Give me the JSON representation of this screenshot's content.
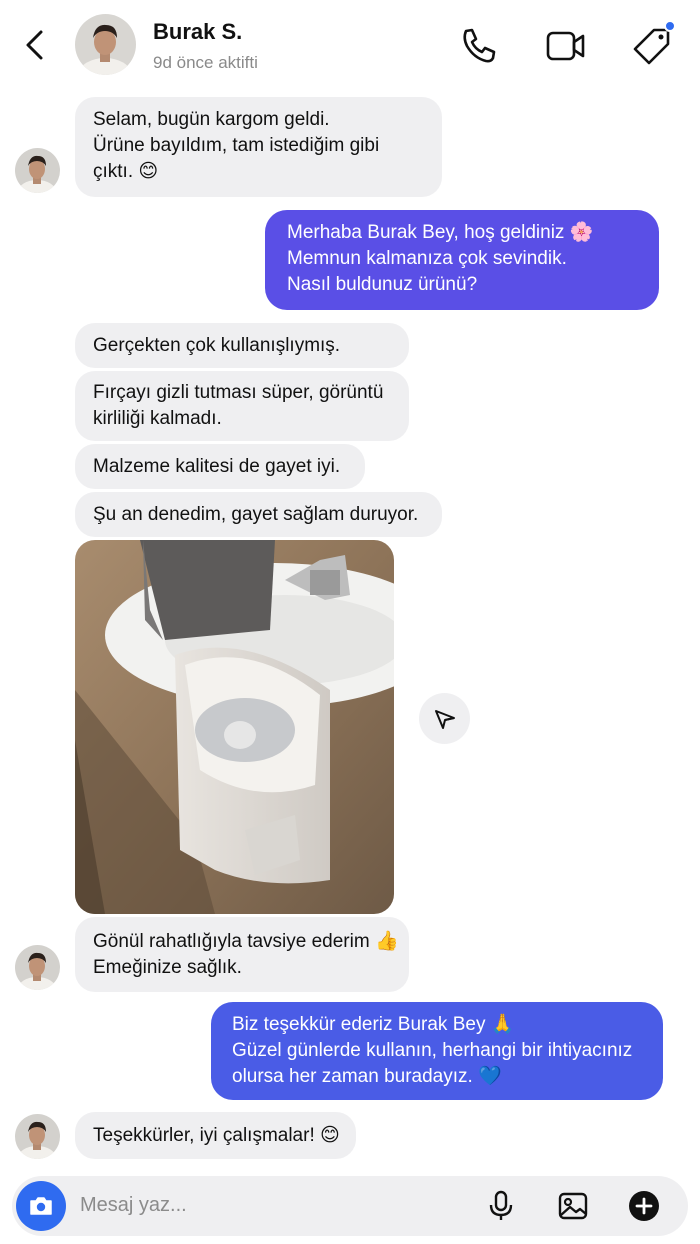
{
  "header": {
    "contact_name": "Burak S.",
    "status": "9d önce aktifti",
    "back_icon": "chevron-left-icon",
    "call_icon": "phone-icon",
    "video_icon": "video-camera-icon",
    "tag_icon": "tag-icon",
    "notification_dot_color": "#2f6bf0"
  },
  "messages": [
    {
      "from": "contact",
      "lines": [
        "Selam, bugün kargom geldi.",
        "Ürüne bayıldım, tam istediğim gibi",
        "çıktı. 😊"
      ]
    },
    {
      "from": "me",
      "lines": [
        "Merhaba Burak Bey, hoş geldiniz 🌸",
        "Memnun kalmanıza çok sevindik.",
        "Nasıl buldunuz ürünü?"
      ]
    },
    {
      "from": "contact",
      "lines": [
        "Gerçekten çok kullanışlıymış."
      ]
    },
    {
      "from": "contact",
      "lines": [
        "Fırçayı gizli tutması süper, görüntü",
        "kirliliği kalmadı."
      ]
    },
    {
      "from": "contact",
      "lines": [
        "Malzeme kalitesi de gayet iyi."
      ]
    },
    {
      "from": "contact",
      "lines": [
        "Şu an denedim, gayet sağlam duruyor."
      ]
    },
    {
      "from": "contact",
      "lines": [
        "Gönül rahatlığıyla tavsiye ederim 👍",
        "Emeğinize sağlık."
      ]
    },
    {
      "from": "me",
      "lines": [
        "Biz teşekkür ederiz Burak Bey 🙏",
        "Güzel günlerde kullanın, herhangi bir ihtiyacınız",
        "olursa her zaman buradayız. 💙"
      ]
    },
    {
      "from": "contact",
      "lines": [
        "Teşekkürler, iyi çalışmalar! 😊"
      ]
    }
  ],
  "composer": {
    "placeholder": "Mesaj yaz...",
    "camera_icon": "camera-icon",
    "mic_icon": "microphone-icon",
    "gallery_icon": "image-icon",
    "add_icon": "plus-circle-icon"
  },
  "colors": {
    "outgoing_bubble_1": "#5a4fe6",
    "outgoing_bubble_2": "#4a5ce6",
    "incoming_bubble": "#efeff1",
    "accent": "#2f6bf0"
  }
}
